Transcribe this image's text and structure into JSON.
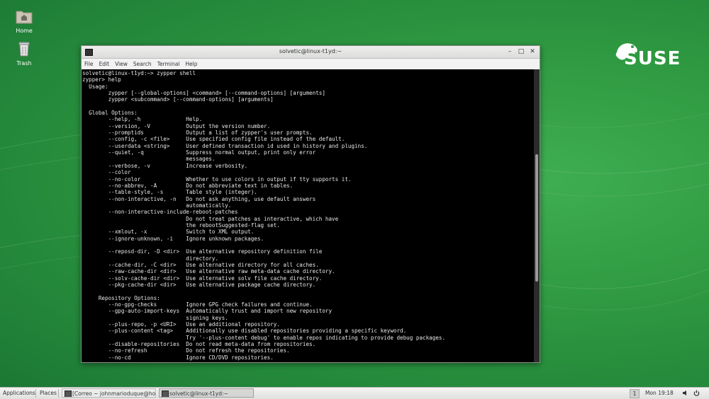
{
  "desktop": {
    "icons": [
      {
        "label": "Home",
        "icon": "folder-home-icon"
      },
      {
        "label": "Trash",
        "icon": "trash-icon"
      }
    ],
    "brand": "SUSE"
  },
  "window": {
    "title": "solvetic@linux-t1yd:~",
    "menu": [
      "File",
      "Edit",
      "View",
      "Search",
      "Terminal",
      "Help"
    ],
    "terminal_lines": [
      "solvetic@linux-t1yd:~> zypper shell",
      "zypper> help",
      "  Usage:",
      "        zypper [--global-options] <command> [--command-options] [arguments]",
      "        zypper <subcommand> [--command-options] [arguments]",
      "",
      "  Global Options:",
      "        --help, -h              Help.",
      "        --version, -V           Output the version number.",
      "        --promptids             Output a list of zypper's user prompts.",
      "        --config, -c <file>     Use specified config file instead of the default.",
      "        --userdata <string>     User defined transaction id used in history and plugins.",
      "        --quiet, -q             Suppress normal output, print only error",
      "                                messages.",
      "        --verbose, -v           Increase verbosity.",
      "        --color",
      "        --no-color              Whether to use colors in output if tty supports it.",
      "        --no-abbrev, -A         Do not abbreviate text in tables.",
      "        --table-style, -s       Table style (integer).",
      "        --non-interactive, -n   Do not ask anything, use default answers",
      "                                automatically.",
      "        --non-interactive-include-reboot-patches",
      "                                Do not treat patches as interactive, which have",
      "                                the rebootSuggested-flag set.",
      "        --xmlout, -x            Switch to XML output.",
      "        --ignore-unknown, -i    Ignore unknown packages.",
      "",
      "        --reposd-dir, -D <dir>  Use alternative repository definition file",
      "                                directory.",
      "        --cache-dir, -C <dir>   Use alternative directory for all caches.",
      "        --raw-cache-dir <dir>   Use alternative raw meta-data cache directory.",
      "        --solv-cache-dir <dir>  Use alternative solv file cache directory.",
      "        --pkg-cache-dir <dir>   Use alternative package cache directory.",
      "",
      "     Repository Options:",
      "        --no-gpg-checks         Ignore GPG check failures and continue.",
      "        --gpg-auto-import-keys  Automatically trust and import new repository",
      "                                signing keys.",
      "        --plus-repo, -p <URI>   Use an additional repository.",
      "        --plus-content <tag>    Additionally use disabled repositories providing a specific keyword.",
      "                                Try '--plus-content debug' to enable repos indicating to provide debug packages.",
      "        --disable-repositories  Do not read meta-data from repositories.",
      "        --no-refresh            Do not refresh the repositories.",
      "        --no-cd                 Ignore CD/DVD repositories."
    ]
  },
  "taskbar": {
    "applications": "Applications",
    "places": "Places",
    "tasks": [
      {
        "label": "[Correo ~ johnmarioduque@hotmail....",
        "active": false
      },
      {
        "label": "solvetic@linux-t1yd:~",
        "active": true
      }
    ],
    "workspace": "1",
    "clock": "Mon 19:18"
  },
  "colors": {
    "desktop": "#2f9a41",
    "terminal_bg": "#000000",
    "terminal_fg": "#e8e8e8"
  }
}
